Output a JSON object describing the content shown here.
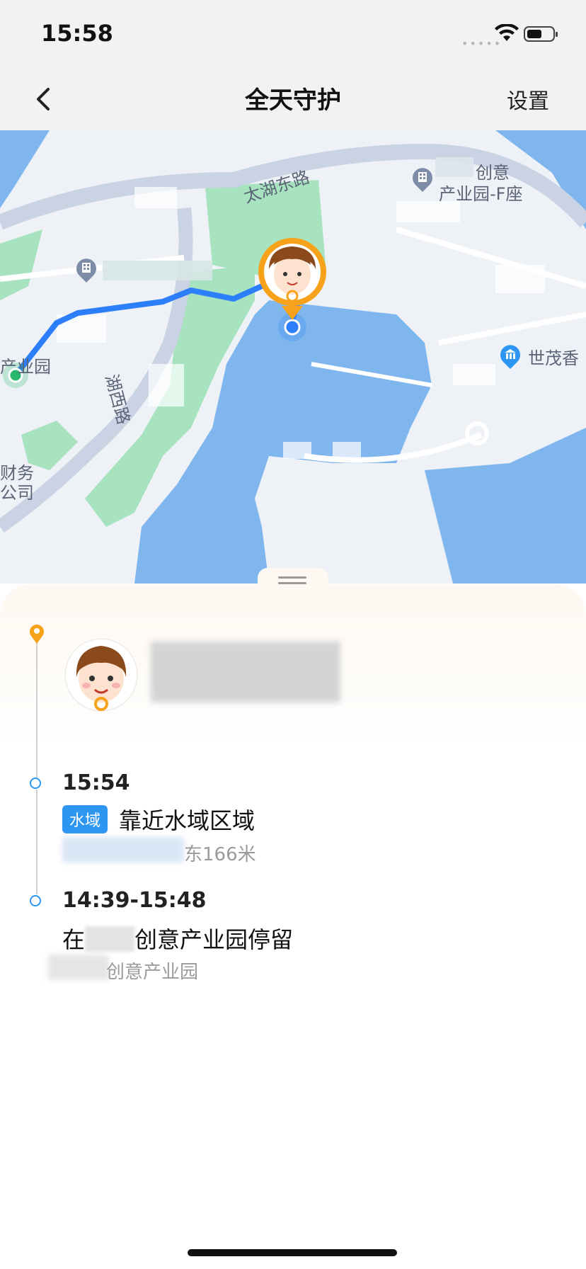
{
  "status_bar": {
    "time": "15:58",
    "signal_dots": "•••••"
  },
  "nav": {
    "title": "全天守护",
    "settings_label": "设置"
  },
  "map": {
    "road_taihu_east": "太湖东路",
    "road_hu_west": "湖西路",
    "poi_chuangyi_line1": "创意",
    "poi_chuangyi_line2": "产业园-F座",
    "poi_shimao": "世茂香",
    "poi_left_park": "产业园",
    "poi_finance_line1": "财务",
    "poi_finance_line2": "公司",
    "colors": {
      "water": "#7fb6ee",
      "green": "#a6e3be",
      "road": "#c9d3e3",
      "route": "#2d7ff9",
      "start": "#27b86b",
      "marker_ring": "#f7a21b"
    }
  },
  "sheet": {
    "events": [
      {
        "time": "15:54",
        "tag": "水域",
        "title": "靠近水域区域",
        "subtitle_suffix": "东166米"
      },
      {
        "time": "14:39-15:48",
        "title_prefix": "在",
        "title_suffix": "创意产业园停留",
        "subtitle_suffix": "创意产业园"
      }
    ],
    "accent": "#2d96f3",
    "pin_color": "#f7a21b"
  }
}
